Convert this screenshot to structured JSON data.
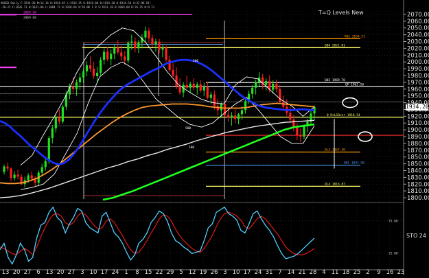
{
  "header": {
    "line1": "AUUSD Daily C:1934.20 N:14.16 H:1934.85 L:1914.35 O:1919.80 B:1934.20 H:1934.50 V:42.9K OI:",
    "line2": "-28-23 C:1826.73 H:1831.06 L:1884.73 H:1918.64 V:58.0K 1 8 S:1923.20 B:2069.60 R:26.35 H:9.73"
  },
  "chart_data": {
    "type": "candlestick",
    "title": "T=Q Levels New",
    "last_price": "1934.20",
    "y_axis": {
      "ylim": [
        1795,
        2075
      ],
      "ticks": [
        2070,
        2060,
        2050,
        2040,
        2030,
        2020,
        2010,
        2000,
        1990,
        1980,
        1970,
        1960,
        1950,
        1940,
        1930,
        1920,
        1910,
        1900,
        1890,
        1880,
        1870,
        1860,
        1850,
        1840,
        1830,
        1820,
        1810,
        1800
      ],
      "tick_labels": [
        "2070.00",
        "2060.00",
        "2050.00",
        "2040.00",
        "2030.00",
        "2020.00",
        "2010.00",
        "2000.00",
        "1990.00",
        "1980.00",
        "1970.00",
        "1960.00",
        "1950.00",
        "1940.00",
        "1930.00",
        "1920.00",
        "1910.00",
        "1900.00",
        "1890.00",
        "1880.00",
        "1870.00",
        "1850.00",
        "1850.00",
        "1840.00",
        "1830.00",
        "1820.00",
        "1810.00",
        "1800.00"
      ]
    },
    "x_axis": {
      "labels": [
        "13",
        "20",
        "27",
        "6",
        "13",
        "20",
        "27",
        "3",
        "10",
        "17",
        "24",
        "1",
        "8",
        "15",
        "22",
        "29",
        "5",
        "12",
        "19",
        "26",
        "3",
        "10",
        "17",
        "24",
        "31",
        "7",
        "14",
        "21",
        "28",
        "4",
        "11",
        "18",
        "25",
        "2",
        "9",
        "16",
        "23"
      ]
    },
    "candles": [
      [
        1838,
        1849,
        1834,
        1846
      ],
      [
        1846,
        1852,
        1839,
        1843
      ],
      [
        1843,
        1845,
        1824,
        1829
      ],
      [
        1829,
        1839,
        1825,
        1834
      ],
      [
        1834,
        1841,
        1827,
        1831
      ],
      [
        1831,
        1835,
        1818,
        1820
      ],
      [
        1820,
        1831,
        1815,
        1826
      ],
      [
        1826,
        1836,
        1822,
        1833
      ],
      [
        1833,
        1839,
        1824,
        1828
      ],
      [
        1828,
        1832,
        1817,
        1822
      ],
      [
        1822,
        1840,
        1818,
        1837
      ],
      [
        1837,
        1850,
        1833,
        1845
      ],
      [
        1845,
        1858,
        1840,
        1854
      ],
      [
        1854,
        1891,
        1850,
        1888
      ],
      [
        1888,
        1907,
        1880,
        1902
      ],
      [
        1902,
        1923,
        1896,
        1918
      ],
      [
        1918,
        1930,
        1908,
        1912
      ],
      [
        1912,
        1937,
        1909,
        1934
      ],
      [
        1934,
        1957,
        1929,
        1952
      ],
      [
        1952,
        1968,
        1945,
        1963
      ],
      [
        1963,
        1977,
        1955,
        1960
      ],
      [
        1960,
        1974,
        1950,
        1970
      ],
      [
        1970,
        1984,
        1959,
        1977
      ],
      [
        1977,
        1990,
        1969,
        1986
      ],
      [
        1986,
        2001,
        1979,
        1995
      ],
      [
        1995,
        2008,
        1985,
        1990
      ],
      [
        1990,
        2000,
        1975,
        1979
      ],
      [
        1979,
        1993,
        1970,
        1984
      ],
      [
        1984,
        2007,
        1980,
        2003
      ],
      [
        2003,
        2020,
        1996,
        2015
      ],
      [
        2015,
        2022,
        2001,
        2004
      ],
      [
        2004,
        2018,
        1995,
        2012
      ],
      [
        2012,
        2025,
        2004,
        2021
      ],
      [
        2021,
        2032,
        2011,
        2014
      ],
      [
        2014,
        2024,
        2002,
        2008
      ],
      [
        2008,
        2016,
        1996,
        2002
      ],
      [
        2002,
        2031,
        1998,
        2028
      ],
      [
        2028,
        2040,
        2018,
        2030
      ],
      [
        2030,
        2036,
        2014,
        2020
      ],
      [
        2020,
        2032,
        2013,
        2029
      ],
      [
        2029,
        2041,
        2020,
        2036
      ],
      [
        2036,
        2052,
        2030,
        2046
      ],
      [
        2046,
        2050,
        2030,
        2035
      ],
      [
        2035,
        2040,
        2022,
        2026
      ],
      [
        2026,
        2034,
        2015,
        2030
      ],
      [
        2030,
        2034,
        2012,
        2018
      ],
      [
        2018,
        2026,
        2007,
        2021
      ],
      [
        2021,
        2024,
        2000,
        2003
      ],
      [
        2003,
        2009,
        1985,
        1988
      ],
      [
        1988,
        1998,
        1978,
        1980
      ],
      [
        1980,
        1992,
        1960,
        1964
      ],
      [
        1964,
        1976,
        1952,
        1955
      ],
      [
        1955,
        1970,
        1948,
        1966
      ],
      [
        1966,
        1980,
        1960,
        1962
      ],
      [
        1962,
        1971,
        1954,
        1968
      ],
      [
        1968,
        1976,
        1958,
        1962
      ],
      [
        1962,
        1970,
        1952,
        1967
      ],
      [
        1967,
        1973,
        1955,
        1958
      ],
      [
        1958,
        1969,
        1950,
        1963
      ],
      [
        1963,
        1970,
        1945,
        1947
      ],
      [
        1947,
        1956,
        1938,
        1952
      ],
      [
        1952,
        1958,
        1930,
        1935
      ],
      [
        1935,
        1946,
        1922,
        1929
      ],
      [
        1929,
        1940,
        1918,
        1938
      ],
      [
        1938,
        1944,
        1918,
        1922
      ],
      [
        1922,
        1933,
        1912,
        1918
      ],
      [
        1918,
        1926,
        1906,
        1921
      ],
      [
        1921,
        1930,
        1910,
        1916
      ],
      [
        1916,
        1925,
        1908,
        1923
      ],
      [
        1923,
        1935,
        1915,
        1929
      ],
      [
        1929,
        1946,
        1924,
        1942
      ],
      [
        1942,
        1958,
        1938,
        1953
      ],
      [
        1953,
        1966,
        1946,
        1962
      ],
      [
        1962,
        1974,
        1952,
        1970
      ],
      [
        1970,
        1985,
        1964,
        1977
      ],
      [
        1977,
        1982,
        1960,
        1966
      ],
      [
        1966,
        1976,
        1958,
        1972
      ],
      [
        1972,
        1980,
        1955,
        1959
      ],
      [
        1959,
        1973,
        1953,
        1968
      ],
      [
        1968,
        1974,
        1955,
        1960
      ],
      [
        1960,
        1966,
        1938,
        1941
      ],
      [
        1941,
        1950,
        1928,
        1934
      ],
      [
        1934,
        1945,
        1920,
        1925
      ],
      [
        1925,
        1934,
        1910,
        1915
      ],
      [
        1915,
        1922,
        1898,
        1903
      ],
      [
        1903,
        1910,
        1885,
        1892
      ],
      [
        1892,
        1902,
        1882,
        1890
      ],
      [
        1890,
        1908,
        1886,
        1905
      ],
      [
        1905,
        1916,
        1896,
        1912
      ],
      [
        1912,
        1928,
        1906,
        1924
      ],
      [
        1924,
        1936,
        1914,
        1934
      ]
    ],
    "overlays": {
      "blue_ma": [
        1913,
        1910,
        1905,
        1898,
        1892,
        1885,
        1878,
        1872,
        1866,
        1860,
        1855,
        1851,
        1849,
        1851,
        1856,
        1864,
        1874,
        1886,
        1898,
        1910,
        1921,
        1931,
        1940,
        1948,
        1956,
        1962,
        1967,
        1971,
        1975,
        1979,
        1983,
        1987,
        1990,
        1994,
        1998,
        2000,
        2002,
        2003,
        2003,
        2002,
        2000,
        1997,
        1993,
        1988,
        1982,
        1976,
        1970,
        1963,
        1957,
        1951,
        1946,
        1942,
        1938,
        1935,
        1933,
        1932,
        1931,
        1930,
        1929,
        1929,
        1929,
        1930,
        1930,
        1929,
        1929
      ],
      "orange_ma": [
        1822,
        1821,
        1821,
        1822,
        1825,
        1829,
        1835,
        1842,
        1850,
        1859,
        1868,
        1877,
        1886,
        1895,
        1903,
        1911,
        1918,
        1924,
        1929,
        1933,
        1935,
        1936,
        1937,
        1938,
        1938,
        1938,
        1937,
        1936,
        1934,
        1933,
        1932,
        1932,
        1932,
        1933,
        1935,
        1937,
        1938,
        1939,
        1938,
        1937,
        1936,
        1935,
        1934
      ],
      "white_ma": [
        1800,
        1801,
        1803,
        1806,
        1810,
        1814,
        1819,
        1824,
        1829,
        1834,
        1839,
        1844,
        1848,
        1853,
        1857,
        1862,
        1866,
        1871,
        1875,
        1879,
        1884,
        1888,
        1892,
        1896,
        1899,
        1902,
        1905,
        1907,
        1909,
        1911,
        1912,
        1913,
        1914
      ],
      "green_ma": [
        1797,
        1800,
        1805,
        1810,
        1816,
        1822,
        1828,
        1834,
        1840,
        1846,
        1852,
        1858,
        1864,
        1870,
        1876,
        1882,
        1888,
        1894,
        1900,
        1904,
        1906,
        1908
      ],
      "bands_upper": [
        1848,
        1862,
        1892,
        1920,
        1950,
        1985,
        2012,
        2025,
        2040,
        2050,
        2046,
        2030,
        2008,
        1985,
        1966,
        1955,
        1945,
        1940,
        1938,
        1966,
        1978,
        1975,
        1960,
        1945,
        1935,
        1920,
        1934
      ],
      "bands_lower": [
        1812,
        1815,
        1820,
        1835,
        1865,
        1895,
        1940,
        1978,
        1992,
        2000,
        1990,
        1968,
        1945,
        1932,
        1918,
        1908,
        1904,
        1910,
        1924,
        1938,
        1948,
        1930,
        1910,
        1890,
        1880,
        1880,
        1906
      ]
    },
    "levels": [
      {
        "label": "R01 2034.21",
        "value": 2034.21,
        "color": "#ff9a00"
      },
      {
        "label": "Q04 2021.01",
        "value": 2021.01,
        "color": "#ffff66"
      },
      {
        "label": "Q03 1969.70",
        "value": 1969.7,
        "color": "#ffffff"
      },
      {
        "label": "QP 1963.50",
        "value": 1963.5,
        "color": "#ffffff"
      },
      {
        "label": "0 RsLSOver 1918.54",
        "value": 1918.54,
        "color": "#ffff66"
      },
      {
        "label": "",
        "value": 1892,
        "color": "#ff3030"
      },
      {
        "label": "QL3 1867.30",
        "value": 1867.3,
        "color": "#ff9a00"
      },
      {
        "label": "Q01 1847.90",
        "value": 1847.9,
        "color": "#4fa0ff"
      },
      {
        "label": "QL4 1816.87",
        "value": 1816.87,
        "color": "#ffff66"
      },
      {
        "label": "2069.60",
        "value": 2069.6,
        "color": "#ff40ff"
      }
    ],
    "annotations": [
      "500",
      "500",
      "500"
    ],
    "oscillator": {
      "label": "STO 24",
      "ticks": [
        "75.00",
        "25.00"
      ],
      "k": [
        30,
        40,
        18,
        8,
        22,
        40,
        30,
        12,
        18,
        48,
        68,
        72,
        88,
        96,
        80,
        74,
        56,
        70,
        80,
        94,
        90,
        72,
        64,
        60,
        56,
        82,
        88,
        72,
        56,
        50,
        40,
        26,
        14,
        22,
        40,
        46,
        56,
        72,
        80,
        90,
        86,
        74,
        56,
        44,
        40,
        34,
        30,
        24,
        26,
        28,
        44,
        64,
        70,
        88,
        92,
        96,
        86,
        82,
        76,
        60,
        56,
        70,
        86,
        90,
        78,
        68,
        60,
        50,
        36,
        24,
        16,
        18,
        20,
        24,
        30,
        36,
        42,
        48
      ],
      "d": [
        34,
        32,
        28,
        24,
        22,
        28,
        32,
        28,
        22,
        34,
        50,
        64,
        76,
        84,
        86,
        82,
        72,
        68,
        72,
        82,
        88,
        84,
        76,
        68,
        62,
        64,
        74,
        78,
        72,
        62,
        52,
        40,
        30,
        24,
        26,
        34,
        44,
        56,
        66,
        78,
        84,
        82,
        74,
        62,
        52,
        44,
        38,
        32,
        28,
        26,
        32,
        42,
        52,
        66,
        78,
        86,
        88,
        86,
        82,
        76,
        66,
        62,
        70,
        78,
        82,
        78,
        70,
        62,
        54,
        44,
        34,
        28,
        24,
        22,
        22,
        24,
        28,
        32
      ]
    }
  },
  "price_box": "1934.20",
  "osc_label": "STO 24"
}
